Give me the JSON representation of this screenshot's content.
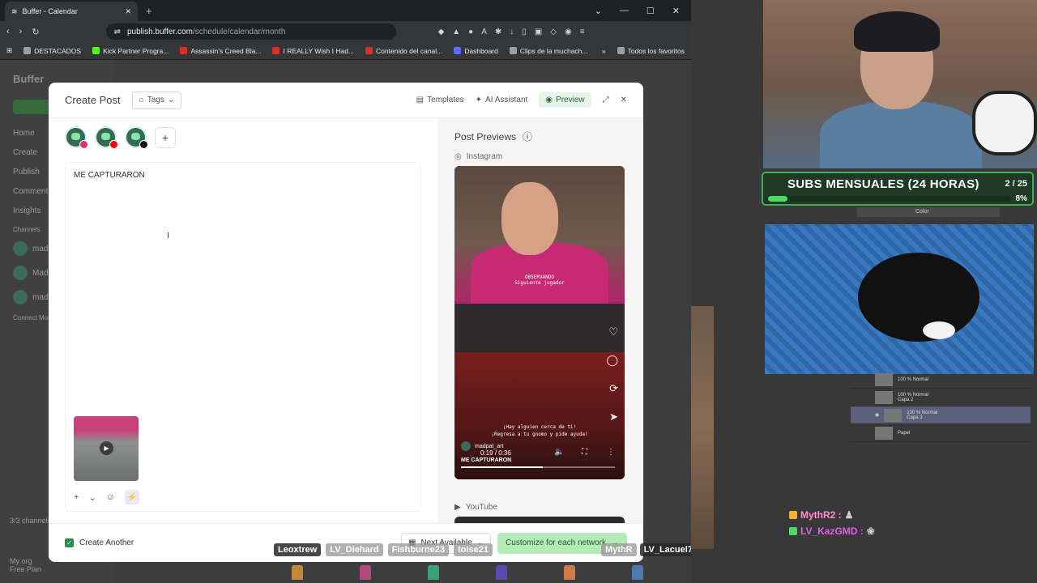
{
  "browser": {
    "tab_title": "Buffer - Calendar",
    "url_host": "publish.buffer.com",
    "url_path": "/schedule/calendar/month",
    "bookmarks": [
      {
        "label": "DESTACADOS",
        "color": "#9aa0a6"
      },
      {
        "label": "Kick Partner Progra...",
        "color": "#53fc18"
      },
      {
        "label": "Assassin's Creed Bla...",
        "color": "#d93025"
      },
      {
        "label": "I REALLY Wish I Had...",
        "color": "#d93025"
      },
      {
        "label": "Contenido del canal...",
        "color": "#d93025"
      },
      {
        "label": "Dashboard",
        "color": "#5b6cff"
      },
      {
        "label": "Clips de la muchach...",
        "color": "#9aa0a6"
      }
    ],
    "all_bookmarks": "Todos los favoritos"
  },
  "bg_app": {
    "logo": "Buffer",
    "nav": [
      "Home",
      "Create",
      "Publish",
      "Comments",
      "Insights"
    ],
    "channels_section": "Channels",
    "channels": [
      "madp",
      "Madp",
      "madp"
    ],
    "connect": "Connect More",
    "channels_used": "3/3 channels",
    "account": "My org",
    "plan": "Free Plan"
  },
  "modal": {
    "title": "Create Post",
    "tags_label": "Tags",
    "templates_label": "Templates",
    "ai_label": "AI Assistant",
    "preview_label": "Preview",
    "post_text": "ME CAPTURARON",
    "channels": [
      {
        "network": "instagram",
        "color": "#e1306c"
      },
      {
        "network": "youtube",
        "color": "#ff0000"
      },
      {
        "network": "tiktok",
        "color": "#111111"
      }
    ],
    "post_previews_label": "Post Previews",
    "instagram_label": "Instagram",
    "youtube_label": "YouTube",
    "create_another_label": "Create Another",
    "create_another_checked": true,
    "next_available_label": "Next Available",
    "customize_label": "Customize for each network"
  },
  "ig_preview": {
    "observing": "OBSERVANDO",
    "next_player": "Siguiente jugador",
    "caption_line1": "¡Hay alguien cerca de ti!",
    "caption_line2": "¡Regresa a tu gnomo y pide ayuda!",
    "username": "madpat_art",
    "time": "0:19 / 0:36",
    "post_text": "ME CAPTURARON",
    "progress": 0.53
  },
  "overlay": {
    "names": [
      "Leoxtrew",
      "LV_Diehard",
      "Fishburne23",
      "toise21"
    ],
    "names_right": [
      "MythR",
      "LV_Lacuel7"
    ]
  },
  "stream": {
    "subs_label": "SUBS MENSUALES (24 HORAS)",
    "subs_count": "2 / 25",
    "subs_pct": "8%",
    "subs_fill": 0.08,
    "ps_color": "Color",
    "layers": [
      {
        "mode": "100 % Normal",
        "name": "",
        "selected": false
      },
      {
        "mode": "100 % Normal",
        "name": "Capa 2",
        "selected": false
      },
      {
        "mode": "100 % Normal",
        "name": "Capa 3",
        "selected": true
      },
      {
        "mode": "",
        "name": "Papel",
        "selected": false
      }
    ],
    "chat": [
      {
        "user": "MythR2 :",
        "color": "#ff8fd3"
      },
      {
        "user": "LV_KazGMD :",
        "color": "#e45cf0"
      }
    ]
  }
}
